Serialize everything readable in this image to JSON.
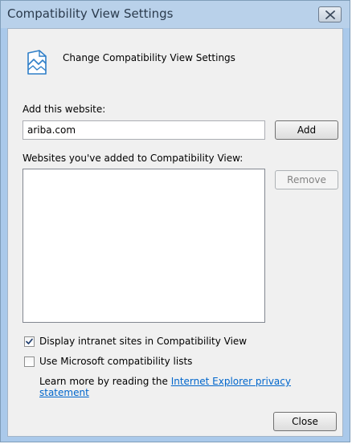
{
  "window": {
    "title": "Compatibility View Settings",
    "close_glyph": "✕"
  },
  "header": {
    "text": "Change Compatibility View Settings"
  },
  "add_section": {
    "label": "Add this website:",
    "input_value": "ariba.com",
    "add_button": "Add"
  },
  "list_section": {
    "label": "Websites you've added to Compatibility View:",
    "items": [],
    "remove_button": "Remove"
  },
  "options": {
    "intranet": {
      "label": "Display intranet sites in Compatibility View",
      "checked": true
    },
    "ms_lists": {
      "label": "Use Microsoft compatibility lists",
      "checked": false
    }
  },
  "learn_more": {
    "prefix": "Learn more by reading the ",
    "link_text": "Internet Explorer privacy statement"
  },
  "footer": {
    "close_button": "Close"
  }
}
